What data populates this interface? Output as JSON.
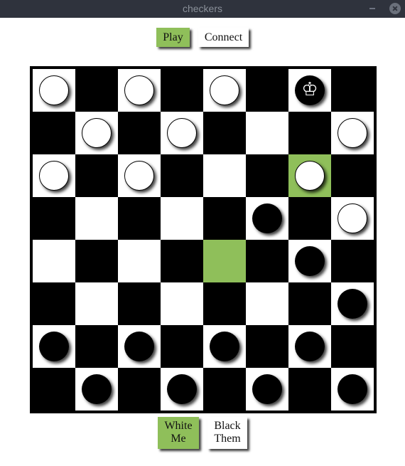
{
  "window": {
    "title": "checkers",
    "minimize_icon": "minimize-icon",
    "close_icon": "close-icon"
  },
  "toolbar": {
    "play_label": "Play",
    "connect_label": "Connect",
    "active": "play"
  },
  "players": {
    "white": {
      "color_label": "White",
      "owner_label": "Me",
      "active": true
    },
    "black": {
      "color_label": "Black",
      "owner_label": "Them",
      "active": false
    }
  },
  "colors": {
    "highlight": "#8fbf5a",
    "light_square": "#ffffff",
    "dark_square": "#000000",
    "titlebar": "#2f333d"
  },
  "board": {
    "size": 8,
    "king_symbol": "♔",
    "highlighted": [
      [
        2,
        6
      ],
      [
        4,
        4
      ]
    ],
    "pieces": [
      {
        "row": 0,
        "col": 0,
        "color": "white",
        "king": false
      },
      {
        "row": 0,
        "col": 2,
        "color": "white",
        "king": false
      },
      {
        "row": 0,
        "col": 4,
        "color": "white",
        "king": false
      },
      {
        "row": 0,
        "col": 6,
        "color": "black",
        "king": true
      },
      {
        "row": 1,
        "col": 1,
        "color": "white",
        "king": false
      },
      {
        "row": 1,
        "col": 3,
        "color": "white",
        "king": false
      },
      {
        "row": 1,
        "col": 7,
        "color": "white",
        "king": false
      },
      {
        "row": 2,
        "col": 0,
        "color": "white",
        "king": false
      },
      {
        "row": 2,
        "col": 2,
        "color": "white",
        "king": false
      },
      {
        "row": 2,
        "col": 6,
        "color": "white",
        "king": false
      },
      {
        "row": 3,
        "col": 5,
        "color": "black",
        "king": false
      },
      {
        "row": 3,
        "col": 7,
        "color": "white",
        "king": false
      },
      {
        "row": 4,
        "col": 6,
        "color": "black",
        "king": false
      },
      {
        "row": 5,
        "col": 7,
        "color": "black",
        "king": false
      },
      {
        "row": 6,
        "col": 0,
        "color": "black",
        "king": false
      },
      {
        "row": 6,
        "col": 2,
        "color": "black",
        "king": false
      },
      {
        "row": 6,
        "col": 4,
        "color": "black",
        "king": false
      },
      {
        "row": 6,
        "col": 6,
        "color": "black",
        "king": false
      },
      {
        "row": 7,
        "col": 1,
        "color": "black",
        "king": false
      },
      {
        "row": 7,
        "col": 3,
        "color": "black",
        "king": false
      },
      {
        "row": 7,
        "col": 5,
        "color": "black",
        "king": false
      },
      {
        "row": 7,
        "col": 7,
        "color": "black",
        "king": false
      }
    ]
  }
}
